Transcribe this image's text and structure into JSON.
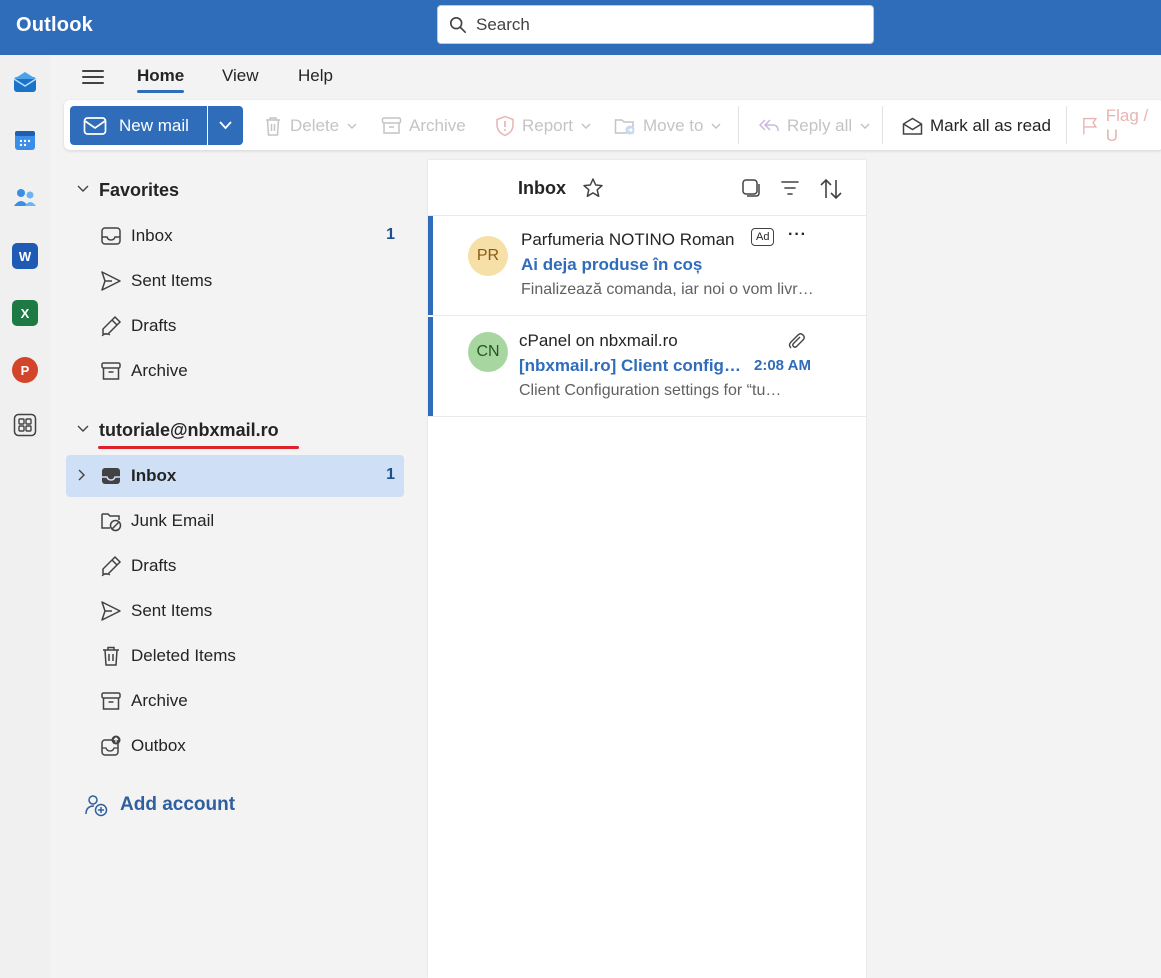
{
  "app": {
    "title": "Outlook"
  },
  "search": {
    "placeholder": "Search"
  },
  "menu": {
    "tabs": [
      {
        "label": "Home",
        "active": true
      },
      {
        "label": "View"
      },
      {
        "label": "Help"
      }
    ]
  },
  "ribbon": {
    "new_mail": "New mail",
    "delete": "Delete",
    "archive": "Archive",
    "report": "Report",
    "move_to": "Move to",
    "reply_all": "Reply all",
    "mark_all_read": "Mark all as read",
    "flag": "Flag / U"
  },
  "favorites": {
    "header": "Favorites",
    "items": [
      {
        "label": "Inbox",
        "count": "1",
        "icon": "inbox-icon"
      },
      {
        "label": "Sent Items",
        "icon": "send-icon"
      },
      {
        "label": "Drafts",
        "icon": "drafts-icon"
      },
      {
        "label": "Archive",
        "icon": "archive-icon"
      }
    ]
  },
  "account": {
    "email": "tutoriale@nbxmail.ro",
    "items": [
      {
        "label": "Inbox",
        "count": "1",
        "icon": "inbox-icon",
        "selected": true
      },
      {
        "label": "Junk Email",
        "icon": "junk-icon"
      },
      {
        "label": "Drafts",
        "icon": "drafts-icon"
      },
      {
        "label": "Sent Items",
        "icon": "send-icon"
      },
      {
        "label": "Deleted Items",
        "icon": "trash-icon"
      },
      {
        "label": "Archive",
        "icon": "archive-icon"
      },
      {
        "label": "Outbox",
        "icon": "outbox-icon"
      }
    ]
  },
  "add_account": "Add account",
  "message_list": {
    "title": "Inbox",
    "messages": [
      {
        "initials": "PR",
        "sender": "Parfumeria NOTINO Roman",
        "badge": "Ad",
        "more": "···",
        "subject": "Ai deja produse în coș",
        "preview": "Finalizează comanda, iar noi o vom livr…",
        "avatar_bg": "#f7e0a8",
        "avatar_fg": "#8a5a10"
      },
      {
        "initials": "CN",
        "sender": "cPanel on nbxmail.ro",
        "subject": "[nbxmail.ro] Client config…",
        "time": "2:08 AM",
        "preview": "Client Configuration settings for “tu…",
        "avatar_bg": "#a8d6a0",
        "avatar_fg": "#1f5a1a"
      }
    ]
  },
  "colors": {
    "brand": "#2f6dbb",
    "selected": "#cfe0f6",
    "underline_red": "#e0202a"
  }
}
